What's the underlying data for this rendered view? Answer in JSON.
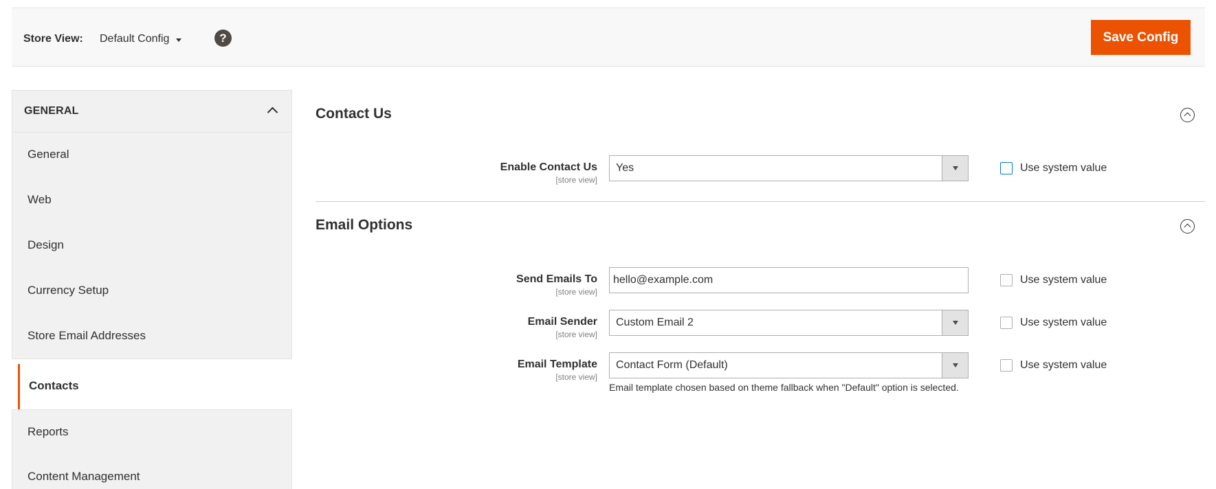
{
  "header": {
    "store_view_label": "Store View:",
    "store_view_value": "Default Config",
    "help_icon": "?",
    "save_label": "Save Config"
  },
  "sidebar": {
    "title": "GENERAL",
    "items": [
      {
        "label": "General",
        "active": false
      },
      {
        "label": "Web",
        "active": false
      },
      {
        "label": "Design",
        "active": false
      },
      {
        "label": "Currency Setup",
        "active": false
      },
      {
        "label": "Store Email Addresses",
        "active": false
      },
      {
        "label": "Contacts",
        "active": true
      },
      {
        "label": "Reports",
        "active": false
      },
      {
        "label": "Content Management",
        "active": false
      }
    ]
  },
  "contact_us": {
    "title": "Contact Us",
    "enable": {
      "label": "Enable Contact Us",
      "scope": "[store view]",
      "value": "Yes",
      "use_system": false
    }
  },
  "email_options": {
    "title": "Email Options",
    "send_to": {
      "label": "Send Emails To",
      "scope": "[store view]",
      "value": "hello@example.com",
      "use_system": false
    },
    "sender": {
      "label": "Email Sender",
      "scope": "[store view]",
      "value": "Custom Email 2",
      "use_system": false
    },
    "template": {
      "label": "Email Template",
      "scope": "[store view]",
      "value": "Contact Form (Default)",
      "use_system": false,
      "note": "Email template chosen based on theme fallback when \"Default\" option is selected."
    }
  },
  "use_system_value_label": "Use system value",
  "colors": {
    "accent": "#eb5202",
    "focus": "#007bdb",
    "sidebar_bg": "#f1f1f1"
  }
}
